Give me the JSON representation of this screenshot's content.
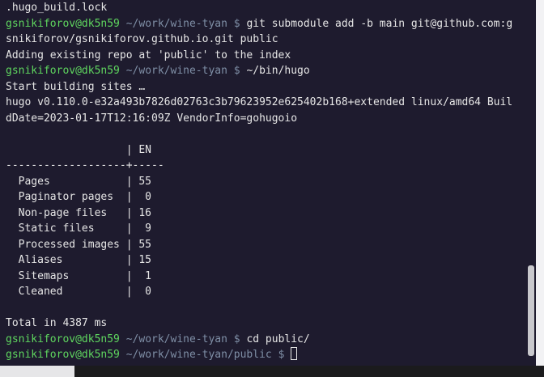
{
  "terminal": {
    "lines": [
      {
        "type": "output",
        "text": ".hugo_build.lock"
      },
      {
        "type": "prompt",
        "user": "gsnikiforov@dk5n59",
        "path": "~/work/wine-tyan",
        "symbol": "$",
        "command": "git submodule add -b main git@github.com:g"
      },
      {
        "type": "output",
        "text": "snikiforov/gsnikiforov.github.io.git public"
      },
      {
        "type": "output",
        "text": "Adding existing repo at 'public' to the index"
      },
      {
        "type": "prompt",
        "user": "gsnikiforov@dk5n59",
        "path": "~/work/wine-tyan",
        "symbol": "$",
        "command": "~/bin/hugo"
      },
      {
        "type": "output",
        "text": "Start building sites …"
      },
      {
        "type": "output",
        "text": "hugo v0.110.0-e32a493b7826d02763c3b79623952e625402b168+extended linux/amd64 Buil"
      },
      {
        "type": "output",
        "text": "dDate=2023-01-17T12:16:09Z VendorInfo=gohugoio"
      },
      {
        "type": "output",
        "text": ""
      },
      {
        "type": "output",
        "text": "                   | EN"
      },
      {
        "type": "output",
        "text": "-------------------+-----"
      },
      {
        "type": "output",
        "text": "  Pages            | 55"
      },
      {
        "type": "output",
        "text": "  Paginator pages  |  0"
      },
      {
        "type": "output",
        "text": "  Non-page files   | 16"
      },
      {
        "type": "output",
        "text": "  Static files     |  9"
      },
      {
        "type": "output",
        "text": "  Processed images | 55"
      },
      {
        "type": "output",
        "text": "  Aliases          | 15"
      },
      {
        "type": "output",
        "text": "  Sitemaps         |  1"
      },
      {
        "type": "output",
        "text": "  Cleaned          |  0"
      },
      {
        "type": "output",
        "text": ""
      },
      {
        "type": "output",
        "text": "Total in 4387 ms"
      },
      {
        "type": "prompt",
        "user": "gsnikiforov@dk5n59",
        "path": "~/work/wine-tyan",
        "symbol": "$",
        "command": "cd public/"
      },
      {
        "type": "prompt",
        "user": "gsnikiforov@dk5n59",
        "path": "~/work/wine-tyan/public",
        "symbol": "$",
        "command": "",
        "cursor": true
      }
    ]
  }
}
